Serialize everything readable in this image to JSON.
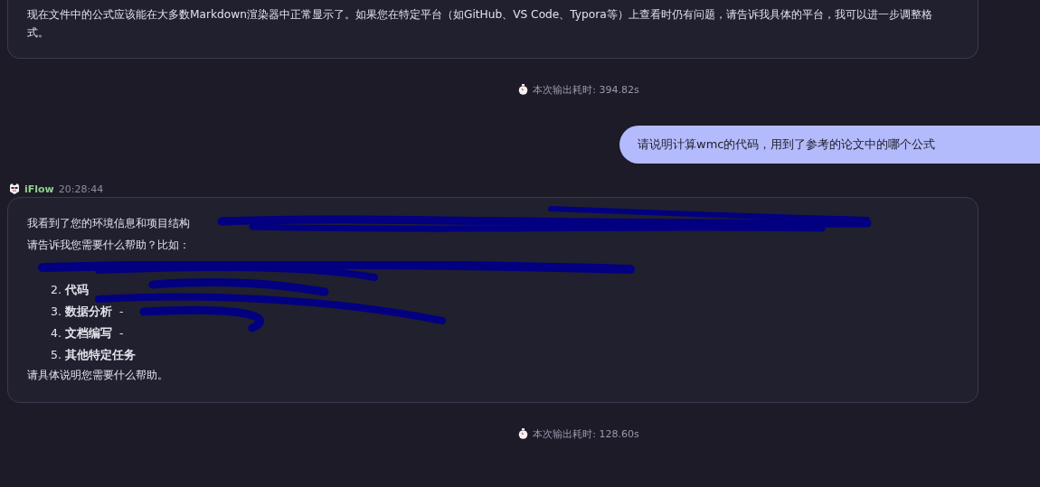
{
  "messages": [
    {
      "kind": "assistant_tail",
      "lines": [
        "现在文件中的公式应该能在大多数Markdown渲染器中正常显示了。如果您在特定平台（如GitHub、VS Code、Typora等）上查看时仍有问题，请告诉我具体的平台，我可以进一步调整格式。"
      ]
    },
    {
      "kind": "timer",
      "text": "本次输出耗时: 394.82s"
    },
    {
      "kind": "user",
      "text": "请说明计算wmc的代码，用到了参考的论文中的哪个公式"
    },
    {
      "kind": "assistant",
      "sender": "iFlow",
      "time": "20:28:44",
      "intro": [
        "我看到了您的环境信息和项目结构",
        "请告诉我您需要什么帮助？比如："
      ],
      "items": [
        {
          "redacted": true
        },
        {
          "number": "2.",
          "title": "代码"
        },
        {
          "number": "3.",
          "title": "数据分析",
          "text": " - "
        },
        {
          "number": "4.",
          "title": "文档编写",
          "text": " - "
        },
        {
          "number": "5.",
          "title": "其他特定任务"
        }
      ],
      "outro": "请具体说明您需要什么帮助。"
    },
    {
      "kind": "timer",
      "text": "本次输出耗时: 128.60s"
    }
  ]
}
